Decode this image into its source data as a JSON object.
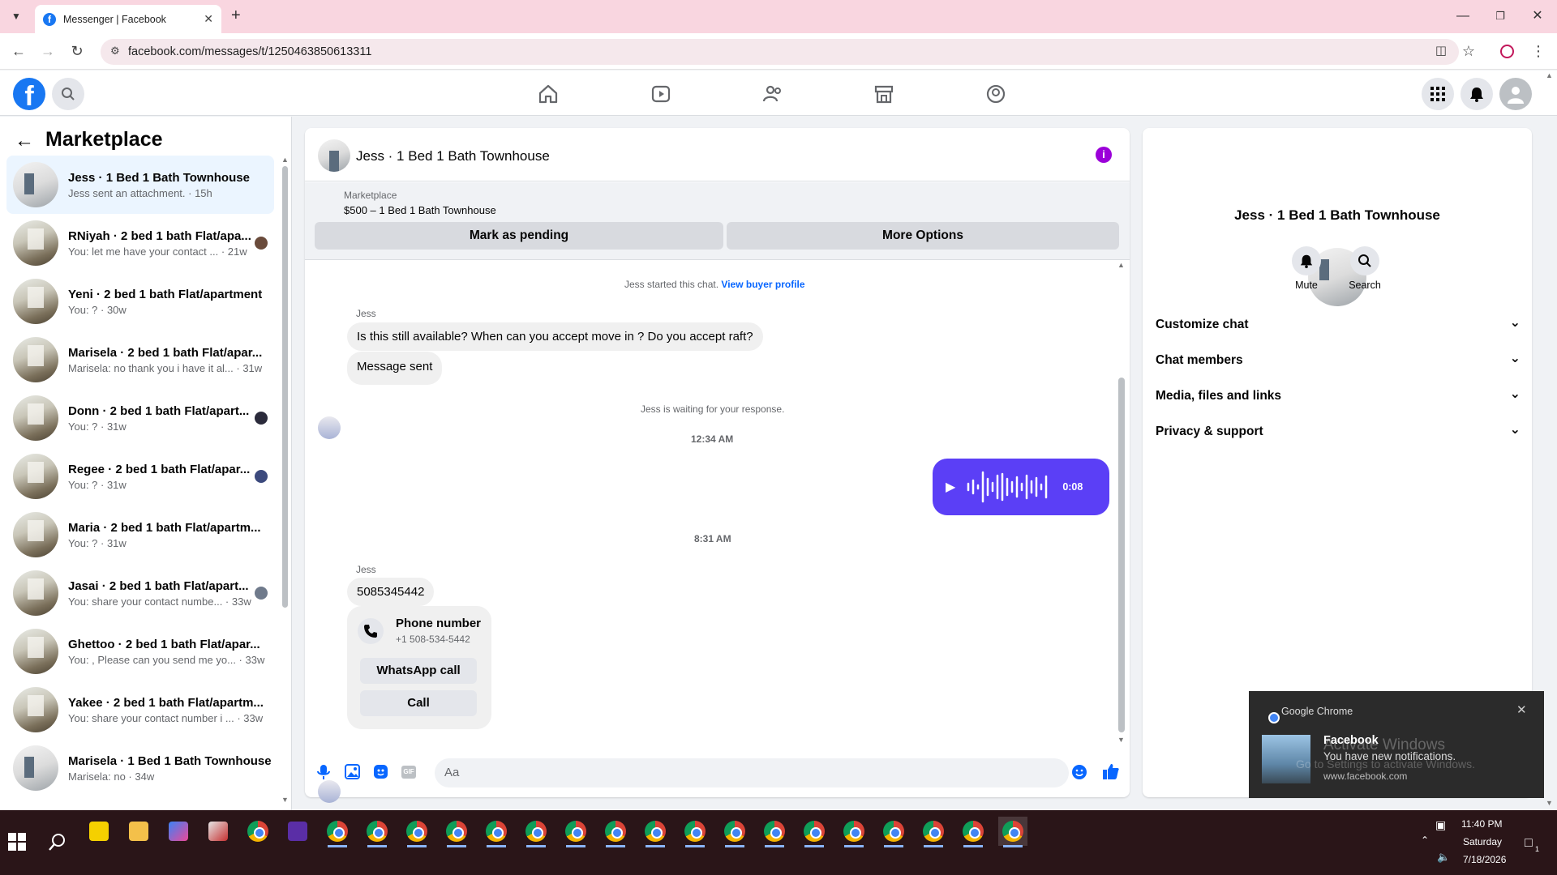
{
  "browser": {
    "tab_title": "Messenger | Facebook",
    "url": "facebook.com/messages/t/1250463850613311"
  },
  "sidebar": {
    "title": "Marketplace",
    "conversations": [
      {
        "name": "Jess · 1 Bed 1 Bath Townhouse",
        "preview": "Jess sent an attachment. · 15h",
        "avatar": "white"
      },
      {
        "name": "RNiyah · 2 bed 1 bath Flat/apa...",
        "preview": "You: let me have your contact ... · 21w",
        "avatar": "room"
      },
      {
        "name": "Yeni · 2 bed 1 bath Flat/apartment",
        "preview": "You: ? · 30w",
        "avatar": "room"
      },
      {
        "name": "Marisela · 2 bed 1 bath Flat/apar...",
        "preview": "Marisela: no thank you i have it al... · 31w",
        "avatar": "room"
      },
      {
        "name": "Donn · 2 bed 1 bath Flat/apart...",
        "preview": "You: ? · 31w",
        "avatar": "room"
      },
      {
        "name": "Regee · 2 bed 1 bath Flat/apar...",
        "preview": "You: ? · 31w",
        "avatar": "room"
      },
      {
        "name": "Maria · 2 bed 1 bath Flat/apartm...",
        "preview": "You: ? · 31w",
        "avatar": "room"
      },
      {
        "name": "Jasai · 2 bed 1 bath Flat/apart...",
        "preview": "You: share your contact numbe... · 33w",
        "avatar": "room"
      },
      {
        "name": "Ghettoo · 2 bed 1 bath Flat/apar...",
        "preview": "You: , Please can you send me yo... · 33w",
        "avatar": "room"
      },
      {
        "name": "Yakee · 2 bed 1 bath Flat/apartm...",
        "preview": "You: share your contact number i ... · 33w",
        "avatar": "room"
      },
      {
        "name": "Marisela · 1 Bed 1 Bath Townhouse",
        "preview": "Marisela: no · 34w",
        "avatar": "white"
      }
    ]
  },
  "chat": {
    "title": "Jess · 1 Bed 1 Bath Townhouse",
    "marketplace_label": "Marketplace",
    "listing": "$500 – 1 Bed 1 Bath Townhouse",
    "mark_pending": "Mark as pending",
    "more_options": "More Options",
    "started_text": "Jess started this chat.",
    "view_profile": "View buyer profile",
    "sender1": "Jess",
    "msg1": "Is this still available? When can you accept move in ? Do you accept raft?",
    "msg2": "Message sent",
    "waiting": "Jess is waiting for your response.",
    "time1": "12:34 AM",
    "voice_duration": "0:08",
    "time2": "8:31 AM",
    "sender2": "Jess",
    "msg3": "5085345442",
    "card_title": "Phone number",
    "card_number": "+1 508-534-5442",
    "whatsapp": "WhatsApp call",
    "call": "Call",
    "composer_placeholder": "Aa"
  },
  "details": {
    "name": "Jess · 1 Bed 1 Bath Townhouse",
    "mute": "Mute",
    "search": "Search",
    "sections": [
      "Customize chat",
      "Chat members",
      "Media, files and links",
      "Privacy & support"
    ]
  },
  "notification": {
    "app": "Google Chrome",
    "title": "Facebook",
    "body": "You have new notifications.",
    "source": "www.facebook.com",
    "watermark1": "Activate Windows",
    "watermark2": "Go to Settings to activate Windows."
  },
  "taskbar": {
    "time": "11:40 PM",
    "day": "Saturday",
    "date": "7/18/2026",
    "notif_count": "1"
  },
  "colors": {
    "brand": "#1877f2",
    "voice": "#5b3ff6",
    "accent": "#0866ff"
  }
}
